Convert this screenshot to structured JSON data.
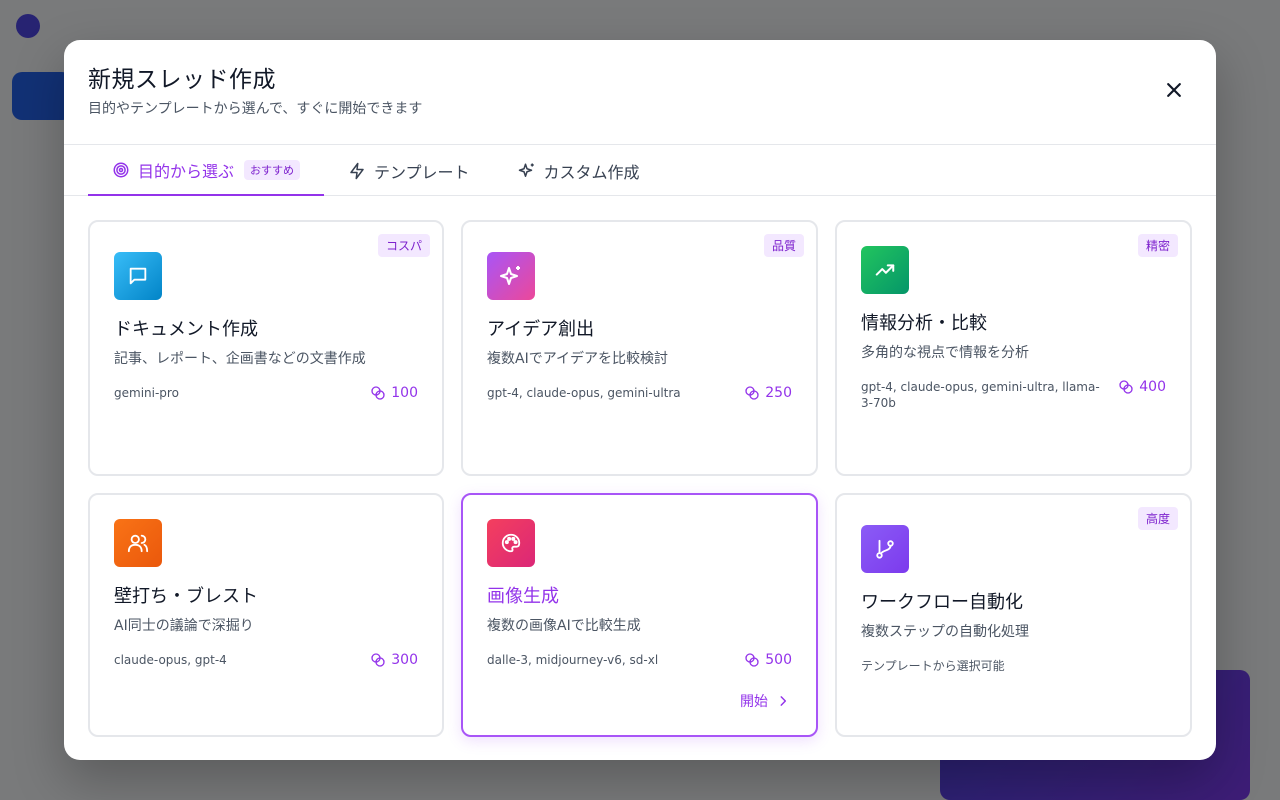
{
  "modal": {
    "title": "新規スレッド作成",
    "subtitle": "目的やテンプレートから選んで、すぐに開始できます"
  },
  "tabs": [
    {
      "label": "目的から選ぶ",
      "badge": "おすすめ",
      "icon": "target-icon",
      "active": true
    },
    {
      "label": "テンプレート",
      "icon": "lightning-icon",
      "active": false
    },
    {
      "label": "カスタム作成",
      "icon": "sparkles-icon",
      "active": false
    }
  ],
  "cards": [
    {
      "title": "ドキュメント作成",
      "desc": "記事、レポート、企画書などの文書作成",
      "models": "gemini-pro",
      "credits": "100",
      "badge": "コスパ",
      "icon": "message-square-icon",
      "color": "#0ea5e9"
    },
    {
      "title": "アイデア創出",
      "desc": "複数AIでアイデアを比較検討",
      "models": "gpt-4, claude-opus, gemini-ultra",
      "credits": "250",
      "badge": "品質",
      "icon": "sparkles-icon",
      "color": "#c026d3"
    },
    {
      "title": "情報分析・比較",
      "desc": "多角的な視点で情報を分析",
      "models": "gpt-4, claude-opus, gemini-ultra, llama-3-70b",
      "credits": "400",
      "badge": "精密",
      "icon": "trending-up-icon",
      "color": "#10b981"
    },
    {
      "title": "壁打ち・ブレスト",
      "desc": "AI同士の議論で深掘り",
      "models": "claude-opus, gpt-4",
      "credits": "300",
      "icon": "users-icon",
      "color": "#f97316"
    },
    {
      "title": "画像生成",
      "desc": "複数の画像AIで比較生成",
      "models": "dalle-3, midjourney-v6, sd-xl",
      "credits": "500",
      "icon": "palette-icon",
      "color": "#e11d48",
      "selected": true,
      "action": "開始"
    },
    {
      "title": "ワークフロー自動化",
      "desc": "複数ステップの自動化処理",
      "models": "テンプレートから選択可能",
      "badge": "高度",
      "icon": "git-branch-icon",
      "color": "#8b5cf6"
    }
  ]
}
